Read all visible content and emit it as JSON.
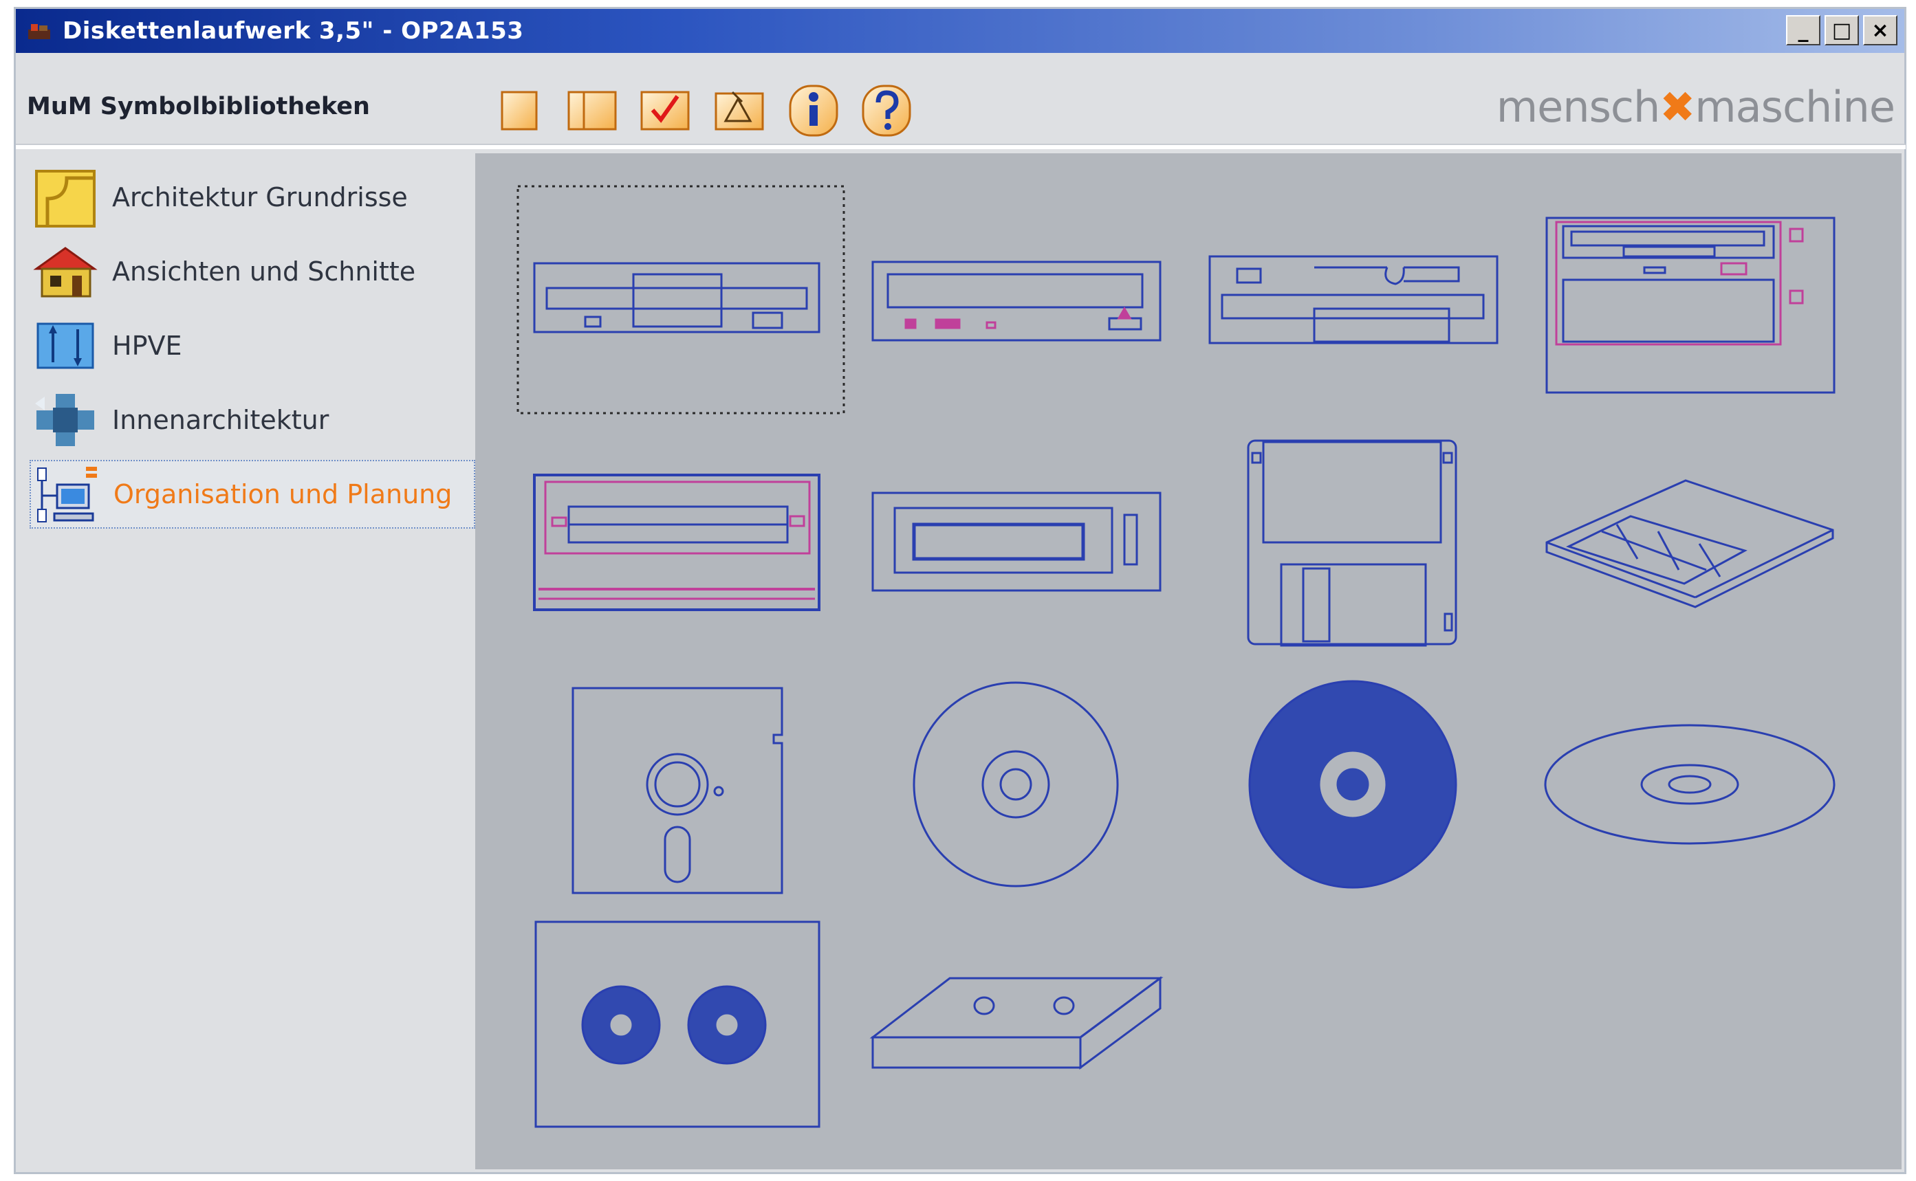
{
  "window": {
    "title": "Diskettenlaufwerk 3,5\" - OP2A153",
    "title_icon": "app-icon",
    "controls": {
      "minimize": "_",
      "maximize": "□",
      "close": "×"
    }
  },
  "header": {
    "library_title": "MuM Symbolbibliotheken",
    "brand_left": "mensch",
    "brand_mark": "✖",
    "brand_right": "maschine",
    "toolbar_icons": [
      "blank-page-icon",
      "split-page-icon",
      "checkmark-icon",
      "pencil-sheet-icon",
      "info-icon",
      "help-icon"
    ]
  },
  "sidebar": {
    "items": [
      {
        "label": "Architektur Grundrisse",
        "icon": "floorplan-icon",
        "selected": false
      },
      {
        "label": "Ansichten und Schnitte",
        "icon": "house-icon",
        "selected": false
      },
      {
        "label": "HPVE",
        "icon": "arrows-icon",
        "selected": false
      },
      {
        "label": "Innenarchitektur",
        "icon": "furniture-icon",
        "selected": false
      },
      {
        "label": "Organisation und Planung",
        "icon": "computer-network-icon",
        "selected": true
      }
    ]
  },
  "symbol_grid": {
    "selected_index": 0,
    "symbols": [
      "floppy-drive-front-1",
      "floppy-drive-front-2",
      "floppy-drive-front-3",
      "drive-bay-unit",
      "drive-front-pink",
      "tape-drive-front",
      "floppy-disk-3-5",
      "floppy-disk-perspective",
      "floppy-disk-5-25",
      "cd-outline",
      "cd-filled",
      "cd-perspective",
      "cassette-front",
      "cassette-perspective"
    ]
  },
  "colors": {
    "symbol_stroke": "#2a3fb0",
    "symbol_fill": "#3149b0",
    "accent": "#f07a18",
    "pink": "#c0409a"
  }
}
